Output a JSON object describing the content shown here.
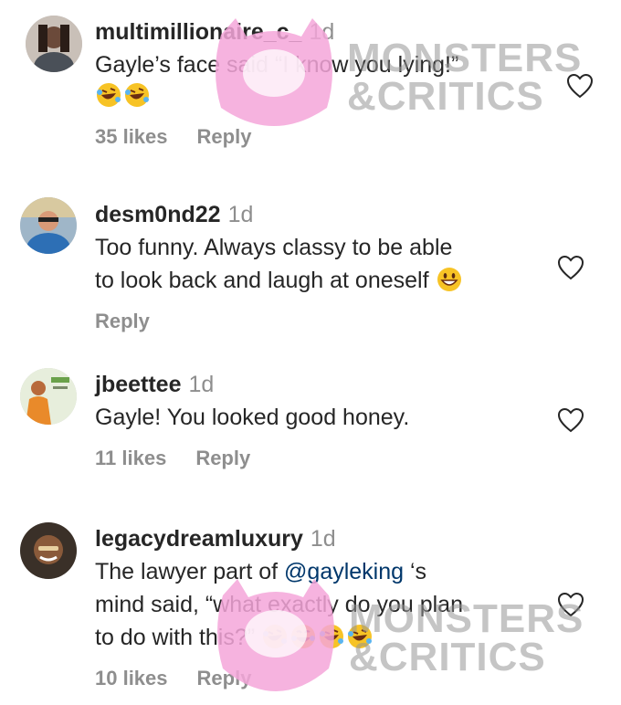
{
  "comments": [
    {
      "username": "multimillionaire_c_",
      "time": "1d",
      "text": "Gayle’s face said “I know you lying!”",
      "emojis": [
        "rofl-emoji",
        "rofl-emoji"
      ],
      "likes": "35 likes",
      "reply": "Reply"
    },
    {
      "username": "desm0nd22",
      "time": "1d",
      "text_line1": "Too funny. Always classy to be able",
      "text_line2": "to look back and laugh at oneself",
      "emojis": [
        "grinning-emoji"
      ],
      "reply": "Reply"
    },
    {
      "username": "jbeettee",
      "time": "1d",
      "text": "Gayle! You looked good honey.",
      "likes": "11 likes",
      "reply": "Reply"
    },
    {
      "username": "legacydreamluxury",
      "time": "1d",
      "text_pre": "The lawyer part of ",
      "mention": "@gayleking",
      "text_post": " ‘s",
      "text_line2": "mind said, “what exactly do you plan",
      "text_line3": "to do with this?”",
      "emojis": [
        "rofl-emoji",
        "laughing-sweat-emoji",
        "rofl-emoji",
        "rofl-emoji"
      ],
      "likes": "10 likes",
      "reply": "Reply"
    }
  ],
  "watermark": {
    "line1": "MONSTERS",
    "line2": "&CRITICS",
    "mascot_color": "#f4a6d9"
  },
  "colors": {
    "text": "#262626",
    "muted": "#8e8e8e",
    "mention": "#00376b"
  }
}
